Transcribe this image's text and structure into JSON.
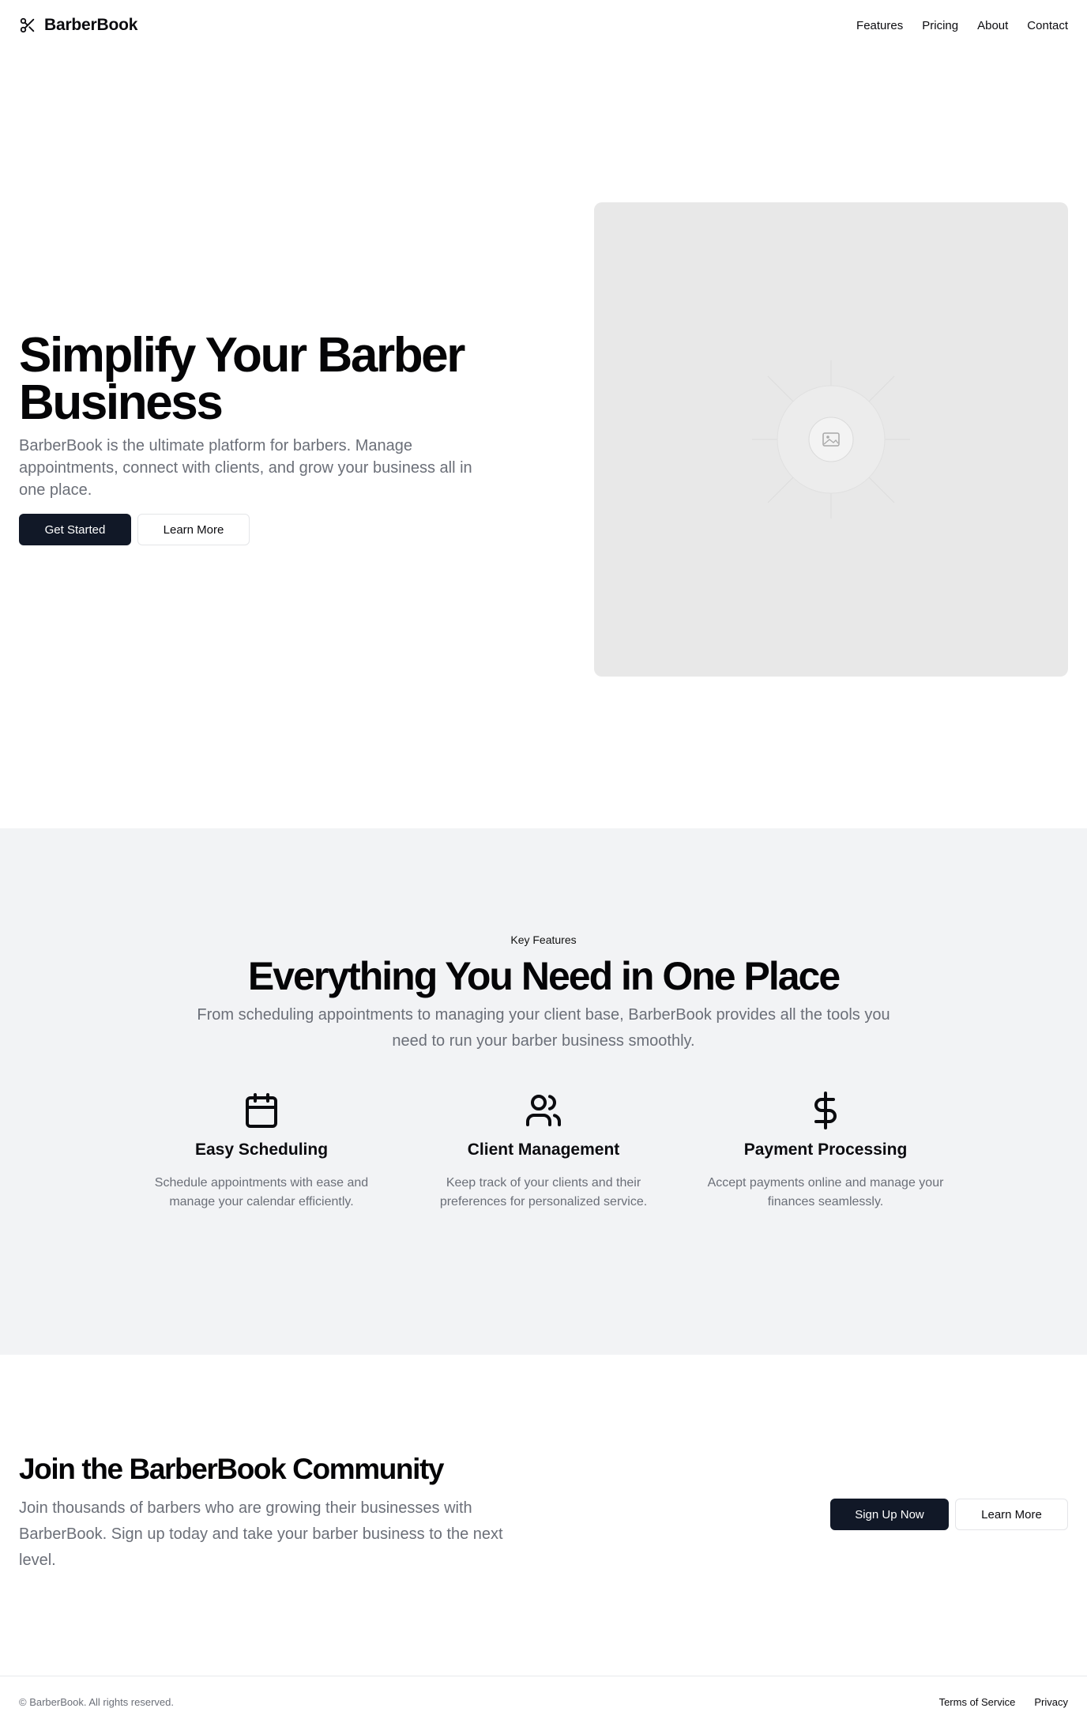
{
  "brand": {
    "name": "BarberBook",
    "icon": "scissors-icon"
  },
  "nav": {
    "items": [
      {
        "label": "Features"
      },
      {
        "label": "Pricing"
      },
      {
        "label": "About"
      },
      {
        "label": "Contact"
      }
    ]
  },
  "hero": {
    "title_line1": "Simplify Your Barber",
    "title_line2": "Business",
    "subtitle": "BarberBook is the ultimate platform for barbers. Manage appointments, connect with clients, and grow your business all in one place.",
    "primary_button": "Get Started",
    "secondary_button": "Learn More",
    "image_icon": "image-placeholder-icon"
  },
  "features": {
    "eyebrow": "Key Features",
    "title": "Everything You Need in One Place",
    "subtitle": "From scheduling appointments to managing your client base, BarberBook provides all the tools you need to run your barber business smoothly.",
    "items": [
      {
        "icon": "calendar-icon",
        "title": "Easy Scheduling",
        "description": "Schedule appointments with ease and manage your calendar efficiently."
      },
      {
        "icon": "users-icon",
        "title": "Client Management",
        "description": "Keep track of your clients and their preferences for personalized service."
      },
      {
        "icon": "dollar-icon",
        "title": "Payment Processing",
        "description": "Accept payments online and manage your finances seamlessly."
      }
    ]
  },
  "community": {
    "title": "Join the BarberBook Community",
    "subtitle": "Join thousands of barbers who are growing their businesses with BarberBook. Sign up today and take your barber business to the next level.",
    "primary_button": "Sign Up Now",
    "secondary_button": "Learn More"
  },
  "footer": {
    "copyright": "© BarberBook. All rights reserved.",
    "links": [
      {
        "label": "Terms of Service"
      },
      {
        "label": "Privacy"
      }
    ]
  },
  "colors": {
    "primary_button": "#111827",
    "muted_text": "#6b6f78",
    "features_background": "#f2f3f5",
    "placeholder_background": "#e8e8e8"
  }
}
